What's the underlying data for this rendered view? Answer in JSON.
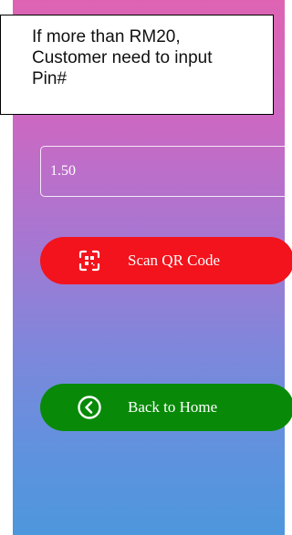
{
  "annotation": {
    "lines": [
      "If more than RM20,",
      "Customer need to input",
      "Pin#"
    ]
  },
  "amount": {
    "value": "1.50"
  },
  "scan_button": {
    "label": "Scan QR Code",
    "icon": "qr-scan-icon",
    "color": "#f3131c"
  },
  "home_button": {
    "label": "Back to Home",
    "icon": "back-circle-icon",
    "color": "#088a08"
  }
}
